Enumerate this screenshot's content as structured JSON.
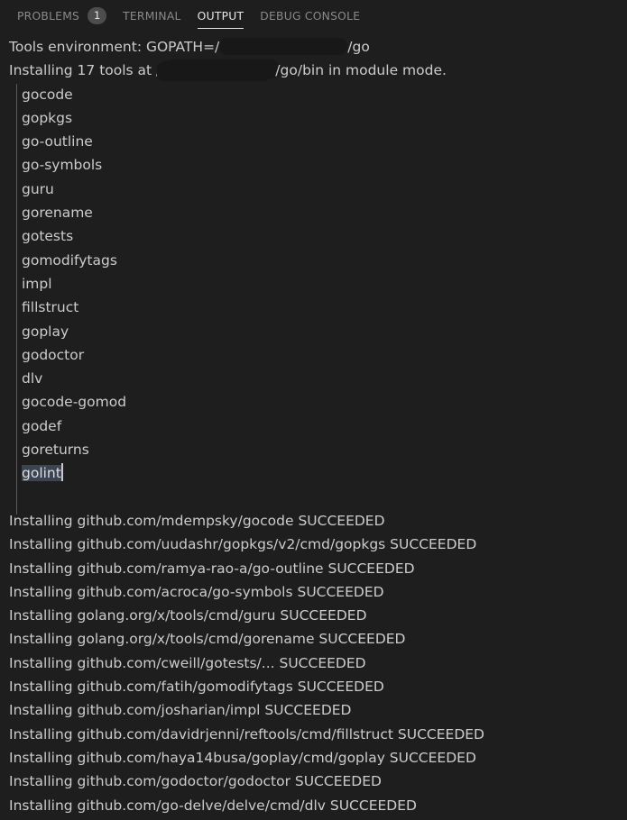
{
  "panel": {
    "tabs": [
      {
        "label": "PROBLEMS",
        "badge": "1",
        "active": false,
        "name": "tab-problems"
      },
      {
        "label": "TERMINAL",
        "badge": null,
        "active": false,
        "name": "tab-terminal"
      },
      {
        "label": "OUTPUT",
        "badge": null,
        "active": true,
        "name": "tab-output"
      },
      {
        "label": "DEBUG CONSOLE",
        "badge": null,
        "active": false,
        "name": "tab-debug-console"
      }
    ]
  },
  "output": {
    "header": {
      "line1_prefix": "Tools environment: GOPATH=/",
      "line1_suffix": "/go",
      "line2_prefix": "Installing 17 tools at /",
      "line2_suffix": "/go/bin in module mode."
    },
    "tool_list": [
      "gocode",
      "gopkgs",
      "go-outline",
      "go-symbols",
      "guru",
      "gorename",
      "gotests",
      "gomodifytags",
      "impl",
      "fillstruct",
      "goplay",
      "godoctor",
      "dlv",
      "gocode-gomod",
      "godef",
      "goreturns"
    ],
    "selected_tool": "golint",
    "install_results": [
      "Installing github.com/mdempsky/gocode SUCCEEDED",
      "Installing github.com/uudashr/gopkgs/v2/cmd/gopkgs SUCCEEDED",
      "Installing github.com/ramya-rao-a/go-outline SUCCEEDED",
      "Installing github.com/acroca/go-symbols SUCCEEDED",
      "Installing golang.org/x/tools/cmd/guru SUCCEEDED",
      "Installing golang.org/x/tools/cmd/gorename SUCCEEDED",
      "Installing github.com/cweill/gotests/... SUCCEEDED",
      "Installing github.com/fatih/gomodifytags SUCCEEDED",
      "Installing github.com/josharian/impl SUCCEEDED",
      "Installing github.com/davidrjenni/reftools/cmd/fillstruct SUCCEEDED",
      "Installing github.com/haya14busa/goplay/cmd/goplay SUCCEEDED",
      "Installing github.com/godoctor/godoctor SUCCEEDED",
      "Installing github.com/go-delve/delve/cmd/dlv SUCCEEDED"
    ]
  },
  "colors": {
    "background": "#1e1e1e",
    "text": "#cccccc",
    "active_tab_text": "#e7e7e7",
    "inactive_tab_text": "#8a8a8a",
    "badge_background": "#4d4d4d",
    "selection": "#3b4552",
    "redaction": "#181818",
    "indent_guide": "#5a5a5a"
  }
}
